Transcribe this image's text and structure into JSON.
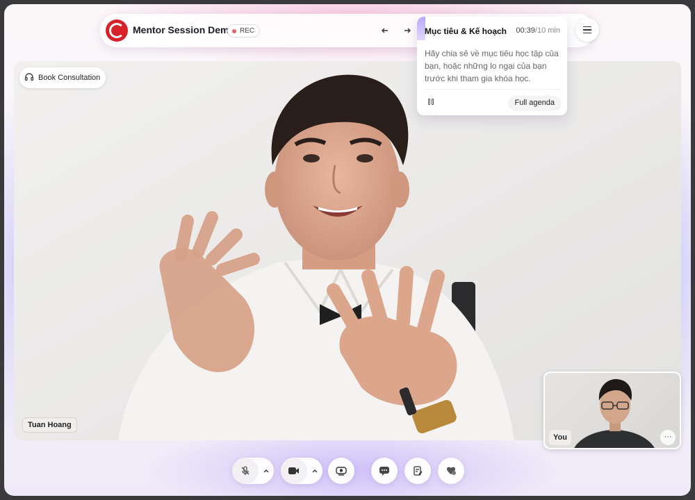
{
  "header": {
    "title": "Mentor Session Demo",
    "rec_label": "REC",
    "back_icon": "arrow-left-icon",
    "forward_icon": "arrow-right-icon",
    "menu_icon": "hamburger-menu-icon"
  },
  "agenda": {
    "title": "Mục tiêu & Kế hoạch",
    "elapsed": "00:39",
    "total": "/10 min",
    "body": "Hãy chia sẻ về mục tiêu học tập của bạn, hoặc những lo ngại của bạn trước khi tham gia khóa học.",
    "full_agenda_label": "Full agenda",
    "pause_icon": "pause-icon"
  },
  "main_video": {
    "book_label": "Book Consultation",
    "book_icon": "headset-icon",
    "participant_name": "Tuan Hoang"
  },
  "self_view": {
    "label": "You",
    "more_label": "···"
  },
  "controls": {
    "mic": "mic-muted-icon",
    "camera": "camera-icon",
    "share": "screen-share-icon",
    "chat": "chat-icon",
    "notes": "notes-icon",
    "reactions": "reaction-icon"
  },
  "colors": {
    "brand": "#d8222a",
    "rec_dot": "#e9606a",
    "accent": "#b9a8f8"
  }
}
